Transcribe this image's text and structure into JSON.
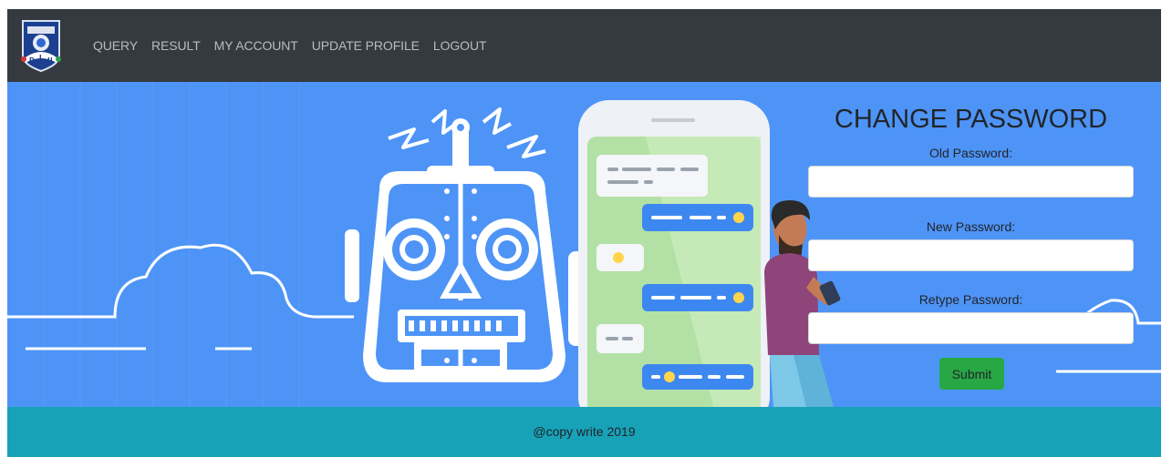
{
  "nav": {
    "logo_icon": "diu-crest-logo",
    "links": [
      "QUERY",
      "RESULT",
      "MY ACCOUNT",
      "UPDATE PROFILE",
      "LOGOUT"
    ]
  },
  "form": {
    "title": "CHANGE PASSWORD",
    "old_label": "Old Password:",
    "old_value": "",
    "new_label": "New Password:",
    "new_value": "",
    "retype_label": "Retype Password:",
    "retype_value": "",
    "submit_label": "Submit"
  },
  "footer": {
    "text": "@copy write 2019"
  },
  "colors": {
    "navbar": "#343a40",
    "hero": "#4e94f7",
    "footer": "#17a2b8",
    "submit": "#28a745"
  }
}
